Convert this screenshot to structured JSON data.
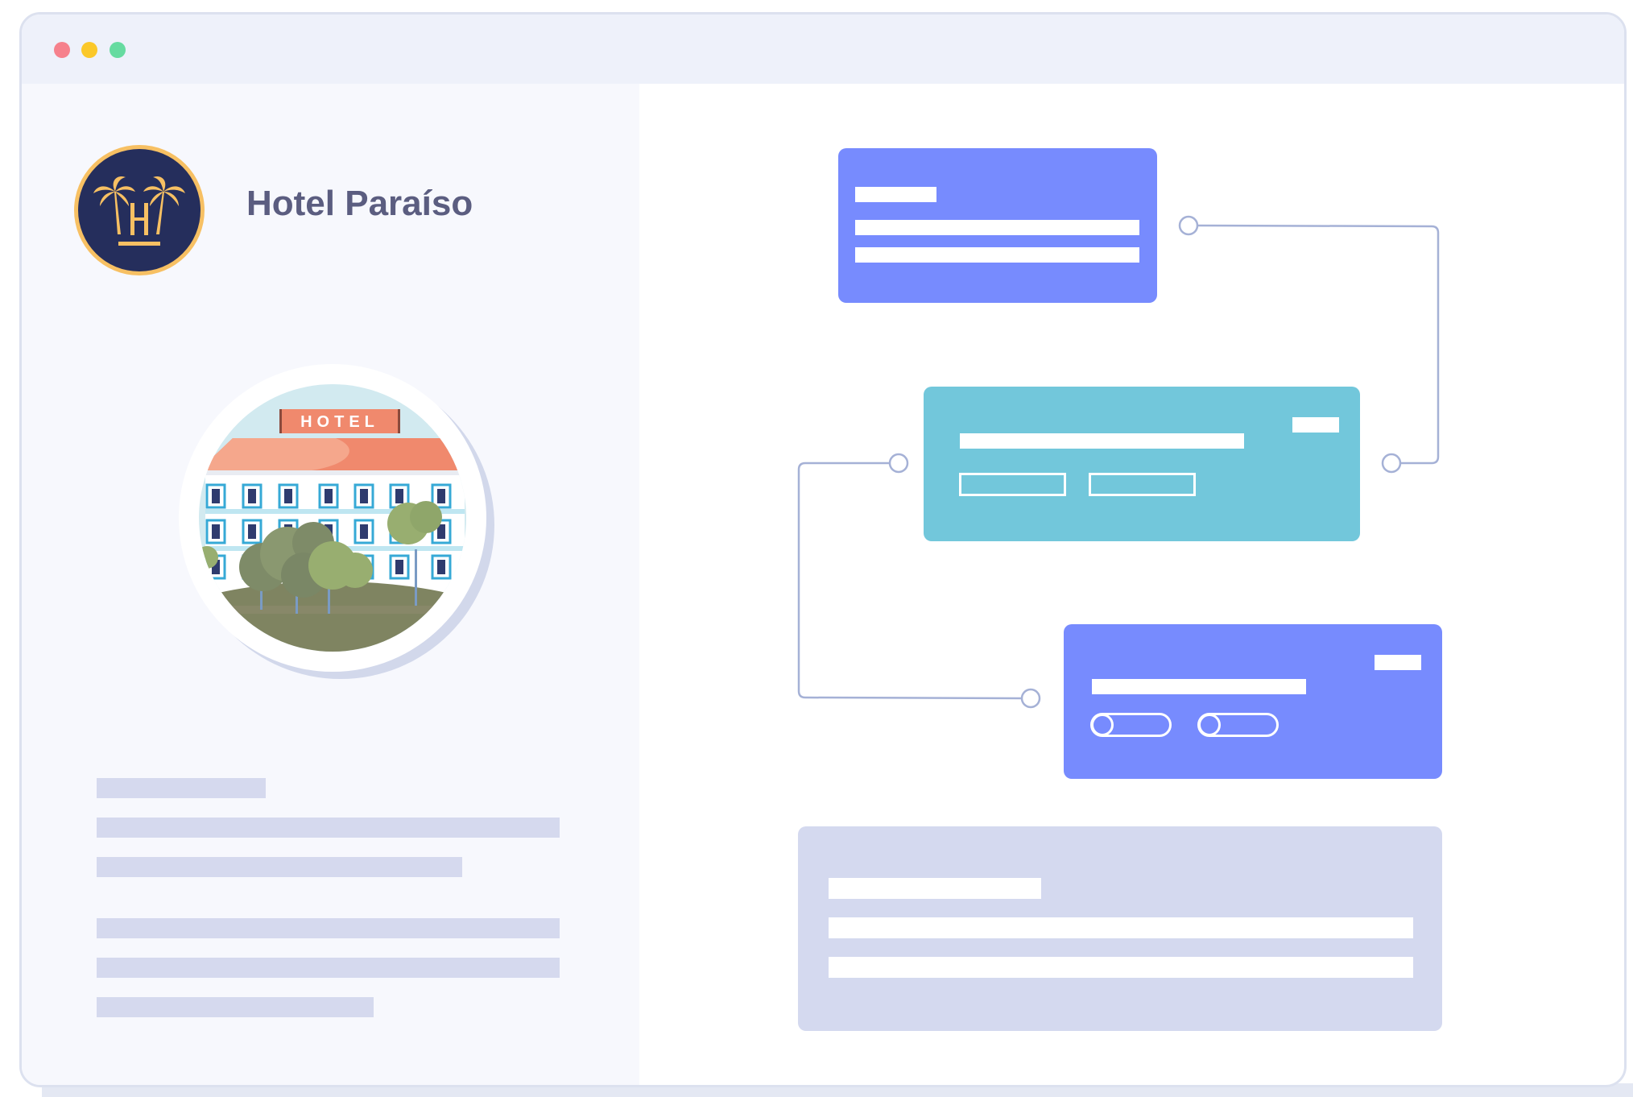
{
  "window": {
    "controls": [
      {
        "name": "close",
        "color": "#f6818c"
      },
      {
        "name": "minimize",
        "color": "#fbc829"
      },
      {
        "name": "maximize",
        "color": "#66dba0"
      }
    ]
  },
  "sidebar": {
    "logo_icon": "palm-tree-h-logo",
    "hotel_name": "Hotel Paraíso",
    "photo": {
      "icon": "hotel-building-illustration",
      "sign_text": "HOTEL"
    }
  },
  "colors": {
    "card_blue": "#778bfe",
    "card_teal": "#72c7db",
    "card_gray": "#d4d9ef",
    "connector": "#a5b1d6",
    "logo_navy": "#252e5c",
    "logo_gold": "#f7c063"
  },
  "workflow": {
    "cards": [
      {
        "name": "blue-top-card",
        "controls": []
      },
      {
        "name": "teal-card",
        "controls": [
          "outlined-input",
          "outlined-input"
        ]
      },
      {
        "name": "blue-bottom-card",
        "controls": [
          "toggle",
          "toggle"
        ]
      },
      {
        "name": "gray-card",
        "controls": []
      }
    ]
  }
}
